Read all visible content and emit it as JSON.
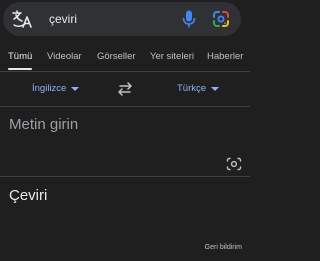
{
  "search": {
    "query": "çeviri",
    "logo_icon": "google-translate-logo-icon",
    "mic_icon": "microphone-icon",
    "lens_icon": "google-lens-icon"
  },
  "tabs": [
    {
      "label": "Tümü",
      "active": true
    },
    {
      "label": "Videolar",
      "active": false
    },
    {
      "label": "Görseller",
      "active": false
    },
    {
      "label": "Yer siteleri",
      "active": false
    },
    {
      "label": "Haberler",
      "active": false
    }
  ],
  "translator": {
    "source_lang": "İngilizce",
    "target_lang": "Türkçe",
    "swap_icon": "swap-arrows-icon",
    "input_placeholder": "Metin girin",
    "camera_icon": "camera-icon",
    "output_text": "Çeviri",
    "feedback_label": "Geri bildirim"
  },
  "colors": {
    "background": "#1f1f1f",
    "search_bg": "#303134",
    "accent": "#8ab4f8",
    "mic_blue": "#4285f4"
  }
}
